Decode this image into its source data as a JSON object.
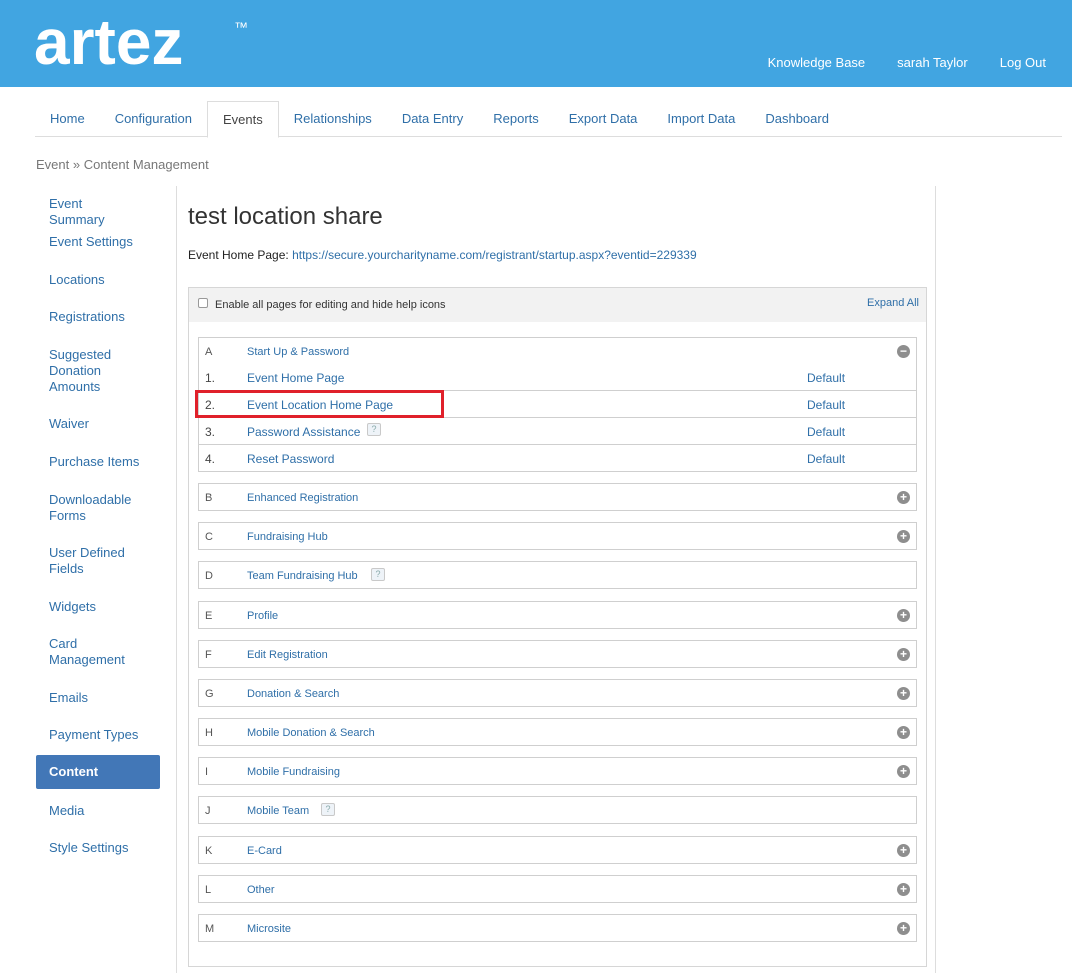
{
  "header": {
    "logo_text": "artez",
    "logo_tm": "™",
    "links": [
      "Knowledge Base",
      "sarah Taylor",
      "Log Out"
    ]
  },
  "tabs": [
    "Home",
    "Configuration",
    "Events",
    "Relationships",
    "Data Entry",
    "Reports",
    "Export Data",
    "Import Data",
    "Dashboard"
  ],
  "active_tab": "Events",
  "breadcrumb": "Event » Content Management",
  "sidebar": [
    "Event Summary",
    "Event Settings",
    "Locations",
    "Registrations",
    "Suggested Donation Amounts",
    "Waiver",
    "Purchase Items",
    "Downloadable Forms",
    "User Defined Fields",
    "Widgets",
    "Card Management",
    "Emails",
    "Payment Types",
    "Content",
    "Media",
    "Style Settings"
  ],
  "sidebar_active": "Content",
  "page": {
    "title": "test location share",
    "home_label": "Event Home Page:",
    "home_url": "https://secure.yourcharityname.com/registrant/startup.aspx?eventid=229339"
  },
  "panel": {
    "checkbox_label": "Enable all pages for editing and hide help icons",
    "expand_all": "Expand All",
    "sections": [
      {
        "letter": "A",
        "title": "Start Up & Password",
        "expanded": true,
        "help": false
      },
      {
        "letter": "B",
        "title": "Enhanced Registration",
        "expanded": false,
        "help": false
      },
      {
        "letter": "C",
        "title": "Fundraising Hub",
        "expanded": false,
        "help": false
      },
      {
        "letter": "D",
        "title": "Team Fundraising Hub",
        "expanded": false,
        "help": true,
        "no_toggle": true
      },
      {
        "letter": "E",
        "title": "Profile",
        "expanded": false,
        "help": false
      },
      {
        "letter": "F",
        "title": "Edit Registration",
        "expanded": false,
        "help": false
      },
      {
        "letter": "G",
        "title": "Donation & Search",
        "expanded": false,
        "help": false
      },
      {
        "letter": "H",
        "title": "Mobile Donation & Search",
        "expanded": false,
        "help": false
      },
      {
        "letter": "I",
        "title": "Mobile Fundraising",
        "expanded": false,
        "help": false
      },
      {
        "letter": "J",
        "title": "Mobile Team",
        "expanded": false,
        "help": true,
        "no_toggle": true
      },
      {
        "letter": "K",
        "title": "E-Card",
        "expanded": false,
        "help": false
      },
      {
        "letter": "L",
        "title": "Other",
        "expanded": false,
        "help": false
      },
      {
        "letter": "M",
        "title": "Microsite",
        "expanded": false,
        "help": false
      }
    ],
    "rows": [
      {
        "num": "1.",
        "name": "Event Home Page",
        "state": "Default",
        "help": false
      },
      {
        "num": "2.",
        "name": "Event Location Home Page",
        "state": "Default",
        "help": false
      },
      {
        "num": "3.",
        "name": "Password Assistance",
        "state": "Default",
        "help": true
      },
      {
        "num": "4.",
        "name": "Reset Password",
        "state": "Default",
        "help": false
      }
    ]
  },
  "colors": {
    "header_bg": "#41a5e1",
    "link": "#2f6fa8",
    "active_sidebar": "#4277b7",
    "highlight": "#e0202a"
  }
}
